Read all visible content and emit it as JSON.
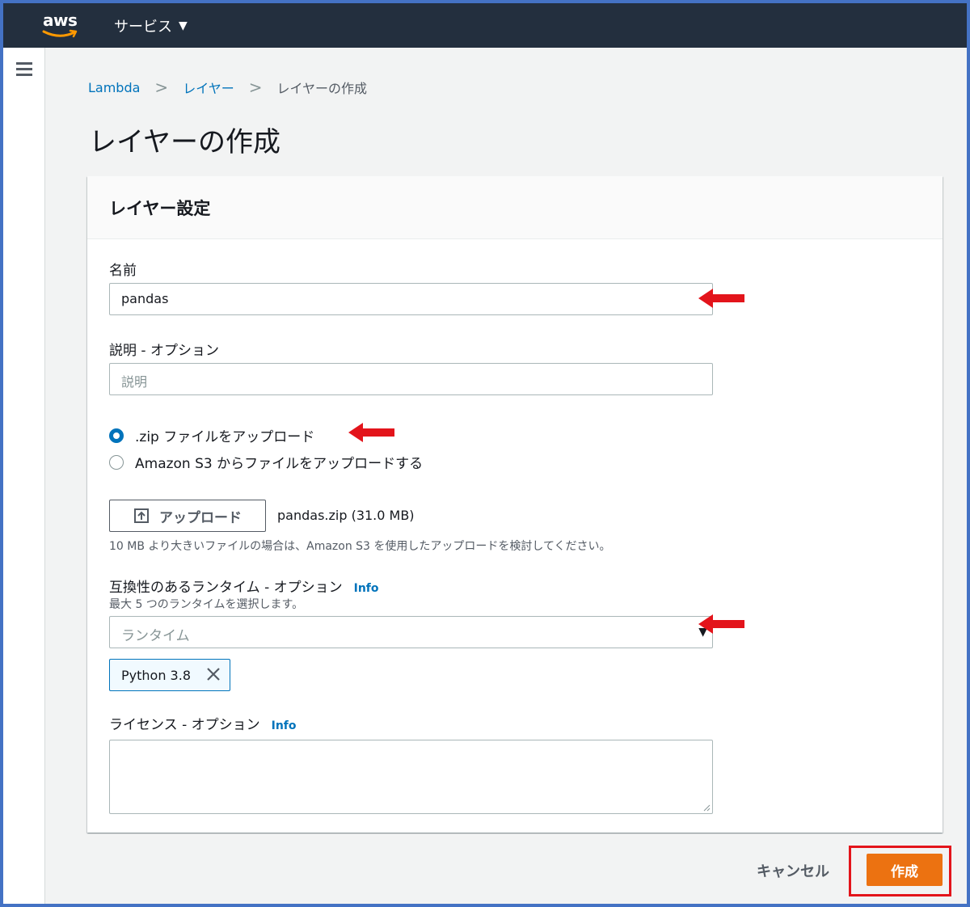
{
  "header": {
    "logo": "aws",
    "services_label": "サービス",
    "services_caret": "▼"
  },
  "breadcrumb": {
    "items": [
      "Lambda",
      "レイヤー"
    ],
    "current": "レイヤーの作成",
    "separator": ">"
  },
  "page_title": "レイヤーの作成",
  "panel": {
    "title": "レイヤー設定",
    "name": {
      "label": "名前",
      "value": "pandas"
    },
    "description": {
      "label": "説明 - オプション",
      "placeholder": "説明"
    },
    "upload_options": [
      {
        "label": ".zip ファイルをアップロード",
        "selected": true
      },
      {
        "label": "Amazon S3 からファイルをアップロードする",
        "selected": false
      }
    ],
    "upload_button": "アップロード",
    "file_name": "pandas.zip (31.0 MB)",
    "upload_hint": "10 MB より大きいファイルの場合は、Amazon S3 を使用したアップロードを検討してください。",
    "runtimes": {
      "label": "互換性のあるランタイム - オプション",
      "info": "Info",
      "description": "最大 5 つのランタイムを選択します。",
      "placeholder": "ランタイム",
      "selected_tokens": [
        "Python 3.8"
      ]
    },
    "license": {
      "label": "ライセンス - オプション",
      "info": "Info",
      "value": ""
    }
  },
  "actions": {
    "cancel": "キャンセル",
    "create": "作成"
  },
  "colors": {
    "nav_bg": "#232f3e",
    "link": "#0073bb",
    "primary": "#ec7211",
    "annotation": "#e3141b",
    "frame": "#4472c4"
  }
}
